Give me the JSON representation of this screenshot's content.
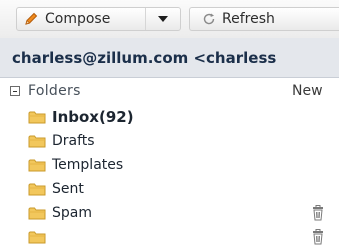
{
  "toolbar": {
    "compose_label": "Compose",
    "refresh_label": "Refresh",
    "compose_icon": "pencil-icon",
    "dropdown_icon": "caret-down-icon",
    "refresh_icon": "refresh-icon"
  },
  "account": {
    "label": "charless@zillum.com <charless"
  },
  "folders": {
    "header_label": "Folders",
    "new_label": "New",
    "items": [
      {
        "label": "Inbox(92)",
        "bold": true
      },
      {
        "label": "Drafts"
      },
      {
        "label": "Templates"
      },
      {
        "label": "Sent"
      },
      {
        "label": "Spam",
        "action_icon": "empty-trash-icon"
      },
      {
        "label": "",
        "action_icon": "empty-trash-icon",
        "partially_visible": true
      }
    ]
  },
  "colors": {
    "folder_icon": "#f2c75c",
    "account_bar": "#e4e7ec",
    "compose_icon": "#e07b1a"
  }
}
